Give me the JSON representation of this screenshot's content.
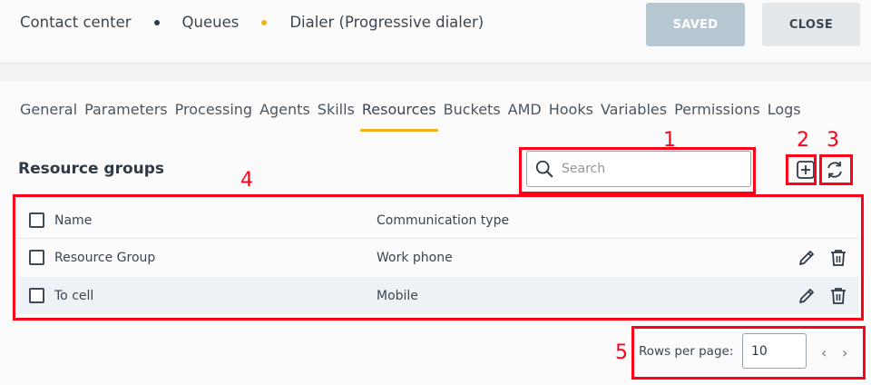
{
  "header": {
    "breadcrumb": [
      {
        "label": "Contact center",
        "dot_color": "#2f3a4f"
      },
      {
        "label": "Queues",
        "dot_color": "#f0b01a"
      },
      {
        "label": "Dialer (Progressive dialer)"
      }
    ],
    "saved_label": "SAVED",
    "close_label": "CLOSE"
  },
  "tabs": [
    "General",
    "Parameters",
    "Processing",
    "Agents",
    "Skills",
    "Resources",
    "Buckets",
    "AMD",
    "Hooks",
    "Variables",
    "Permissions",
    "Logs"
  ],
  "active_tab": "Resources",
  "section": {
    "title": "Resource groups",
    "search_placeholder": "Search",
    "add_icon": "plus-square-icon",
    "refresh_icon": "refresh-icon"
  },
  "table": {
    "columns": [
      "Name",
      "Communication type"
    ],
    "rows": [
      {
        "name": "Resource Group",
        "type": "Work phone"
      },
      {
        "name": "To cell",
        "type": "Mobile"
      }
    ]
  },
  "pagination": {
    "rows_per_page_label": "Rows per page:",
    "rows_per_page_value": "10",
    "prev_symbol": "‹",
    "next_symbol": "›"
  },
  "annotations": [
    "1",
    "2",
    "3",
    "4",
    "5"
  ],
  "colors": {
    "accent": "#f0b01a",
    "annotation": "#ff0018"
  }
}
